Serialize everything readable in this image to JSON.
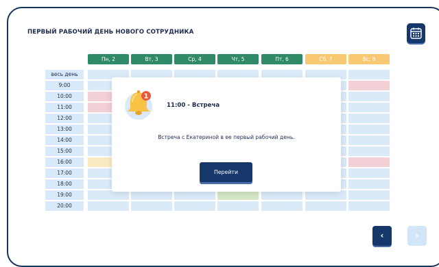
{
  "title": "ПЕРВЫЙ РАБОЧИЙ ДЕНЬ НОВОГО СОТРУДНИКА",
  "icons": {
    "calendar": "calendar-icon",
    "bell": "bell-icon",
    "prev": "chevron-left-icon",
    "next": "chevron-right-icon"
  },
  "days": [
    "Пн, 2",
    "Вт, 3",
    "Ср, 4",
    "Чт, 5",
    "Пт, 6",
    "Сб, 7",
    "Вс, 8"
  ],
  "times": [
    "весь день",
    "9:00",
    "10:00",
    "11:00",
    "12:00",
    "13:00",
    "14:00",
    "15:00",
    "16:00",
    "17:00",
    "18:00",
    "19:00",
    "20:00"
  ],
  "popup": {
    "badge": "1",
    "event_title": "11:00 - Встреча",
    "description": "Встреча с Екатериной в ее первый рабочий день.",
    "button": "Перейти"
  },
  "nav": {
    "prev": "‹",
    "next": "›"
  },
  "colors": {
    "primary": "#16376a",
    "weekday": "#2f8a67",
    "weekend": "#f8c872",
    "cell": "#dbeaf9",
    "pink_event": "#f3cfd6",
    "yellow_event": "#fbe9c3",
    "green_event": "#d5e9c9"
  }
}
